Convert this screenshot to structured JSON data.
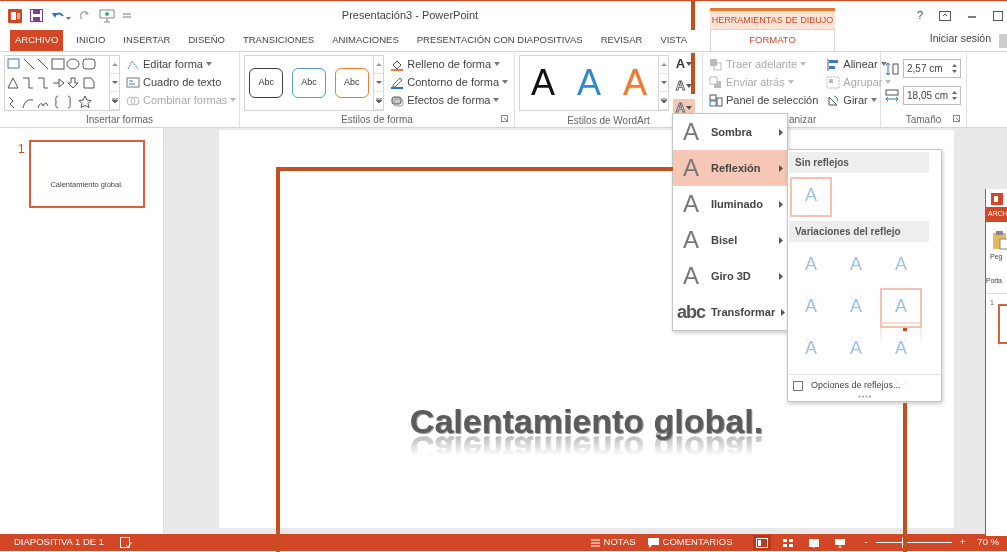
{
  "title_bar": {
    "title": "Presentación3 - PowerPoint",
    "contextual_header": "HERRAMIENTAS DE DIBUJO",
    "help": "?"
  },
  "tabs": [
    {
      "label": "ARCHIVO",
      "kind": "file",
      "selected": false
    },
    {
      "label": "INICIO",
      "kind": "tab",
      "selected": false
    },
    {
      "label": "INSERTAR",
      "kind": "tab",
      "selected": false
    },
    {
      "label": "DISEÑO",
      "kind": "tab",
      "selected": false
    },
    {
      "label": "TRANSICIONES",
      "kind": "tab",
      "selected": false
    },
    {
      "label": "ANIMACIONES",
      "kind": "tab",
      "selected": false
    },
    {
      "label": "PRESENTACIÓN CON DIAPOSITIVAS",
      "kind": "tab",
      "selected": false
    },
    {
      "label": "REVISAR",
      "kind": "tab",
      "selected": false
    },
    {
      "label": "VISTA",
      "kind": "tab",
      "selected": false
    },
    {
      "label": "FORMATO",
      "kind": "contextual",
      "selected": true
    }
  ],
  "sign_in": "Iniciar sesión",
  "ribbon": {
    "insert_shapes": {
      "label": "Insertar formas",
      "commands": [
        {
          "label": "Editar forma",
          "disabled": false,
          "dropdown": true
        },
        {
          "label": "Cuadro de texto",
          "disabled": false,
          "dropdown": false
        },
        {
          "label": "Combinar formas",
          "disabled": true,
          "dropdown": true
        }
      ]
    },
    "shape_styles": {
      "label": "Estilos de forma",
      "swatches": [
        {
          "label": "Abc",
          "color": "#404040"
        },
        {
          "label": "Abc",
          "color": "#5b9bd5"
        },
        {
          "label": "Abc",
          "color": "#ed7d31"
        }
      ],
      "commands": [
        {
          "label": "Relleno de forma",
          "disabled": false,
          "dropdown": true
        },
        {
          "label": "Contorno de forma",
          "disabled": false,
          "dropdown": true
        },
        {
          "label": "Efectos de forma",
          "disabled": false,
          "dropdown": true
        }
      ]
    },
    "wordart_styles": {
      "label": "Estilos de WordArt",
      "samples": [
        {
          "label": "A",
          "kind": "solid",
          "color": "#111111"
        },
        {
          "label": "A",
          "kind": "solid",
          "color": "#2e8bcb"
        },
        {
          "label": "A",
          "kind": "outline",
          "color": "#ed7d31"
        }
      ],
      "text_buttons": [
        {
          "glyph": "A",
          "kind": "fill",
          "selected": false
        },
        {
          "glyph": "A",
          "kind": "outline",
          "selected": false
        },
        {
          "glyph": "A",
          "kind": "effects",
          "selected": true
        }
      ]
    },
    "arrange": {
      "label": "anizar",
      "commands": [
        {
          "label": "Traer adelante",
          "disabled": true,
          "dropdown": true
        },
        {
          "label": "Enviar atrás",
          "disabled": true,
          "dropdown": true
        },
        {
          "label": "Panel de selección",
          "disabled": false,
          "dropdown": false
        },
        {
          "label": "Alinear",
          "disabled": false,
          "dropdown": true
        },
        {
          "label": "Agrupar",
          "disabled": true,
          "dropdown": true
        },
        {
          "label": "Girar",
          "disabled": false,
          "dropdown": true
        }
      ]
    },
    "size": {
      "label": "Tamaño",
      "fields": [
        {
          "value": "2,57 cm"
        },
        {
          "value": "18,05 cm"
        }
      ]
    }
  },
  "thumbnails": [
    {
      "number": "1",
      "text": "Calentamiento global.",
      "selected": true
    }
  ],
  "slide": {
    "title": "Calentamiento global."
  },
  "effects_menu": {
    "items": [
      {
        "label": "Sombra",
        "icon": "A",
        "kind": "effect",
        "selected": false
      },
      {
        "label": "Reflexión",
        "icon": "A",
        "kind": "effect",
        "selected": true
      },
      {
        "label": "Iluminado",
        "icon": "A",
        "kind": "effect",
        "selected": false
      },
      {
        "label": "Bisel",
        "icon": "A",
        "kind": "effect",
        "selected": false
      },
      {
        "label": "Giro 3D",
        "icon": "A",
        "kind": "effect",
        "selected": false
      },
      {
        "label": "Transformar",
        "icon": "abc",
        "kind": "transform",
        "selected": false
      }
    ]
  },
  "reflection_submenu": {
    "sections": [
      {
        "header": "Sin reflejos",
        "reflected": false,
        "tiles": [
          {
            "glyph": "A",
            "selected": true
          }
        ]
      },
      {
        "header": "Variaciones del reflejo",
        "reflected": true,
        "tiles": [
          {
            "glyph": "A",
            "selected": false
          },
          {
            "glyph": "A",
            "selected": false
          },
          {
            "glyph": "A",
            "selected": false
          },
          {
            "glyph": "A",
            "selected": false
          },
          {
            "glyph": "A",
            "selected": false
          },
          {
            "glyph": "A",
            "selected": true
          },
          {
            "glyph": "A",
            "selected": false
          },
          {
            "glyph": "A",
            "selected": false
          },
          {
            "glyph": "A",
            "selected": false
          }
        ]
      }
    ],
    "options": {
      "label": "Opciones de reflejos...",
      "checked": false
    }
  },
  "background_window": {
    "tab": "ARCH",
    "button": "Peg",
    "group": "Porta",
    "slide_number": "1"
  },
  "status_bar": {
    "slide_info": "DIAPOSITIVA 1 DE 1",
    "notes": "NOTAS",
    "comments": "COMENTARIOS",
    "views": [
      {
        "selected": true
      },
      {
        "selected": false
      },
      {
        "selected": false
      },
      {
        "selected": false
      }
    ],
    "zoom": {
      "minus": "-",
      "plus": "+",
      "level": 0.35,
      "reading": "70 %"
    }
  }
}
